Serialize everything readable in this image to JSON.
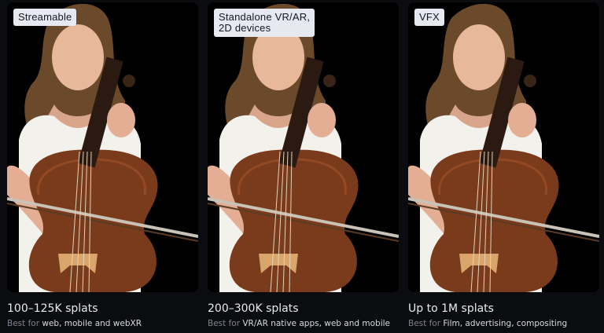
{
  "cards": [
    {
      "tag": "Streamable",
      "title": "100–125K splats",
      "desc_prefix": "Best for",
      "desc_highlight": "web, mobile and webXR"
    },
    {
      "tag": "Standalone VR/AR,\n2D devices",
      "title": "200–300K splats",
      "desc_prefix": "Best for",
      "desc_highlight": "VR/AR native apps, web and mobile"
    },
    {
      "tag": "VFX",
      "title": "Up to 1M splats",
      "desc_prefix": "Best for",
      "desc_highlight": "Film, advertising, compositing"
    }
  ],
  "colors": {
    "background": "#0b0c0f",
    "tag_bg": "#e6e9f0",
    "title_text": "#e8eaef",
    "desc_muted": "#7d828c",
    "desc_highlight": "#d7dae0"
  }
}
